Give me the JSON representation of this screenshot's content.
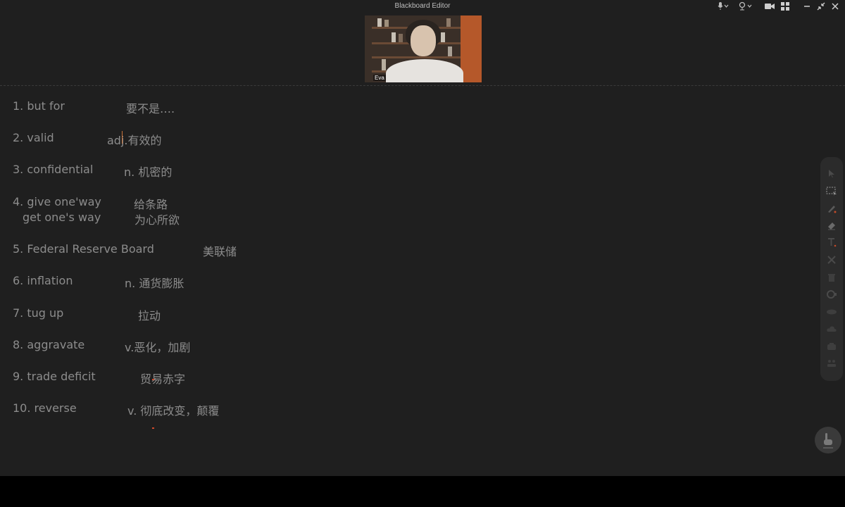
{
  "window": {
    "title": "Blackboard Editor"
  },
  "video": {
    "participant_name": "Eva"
  },
  "vocabulary": [
    {
      "term": "1. but for",
      "definition": "要不是…."
    },
    {
      "term": "2. valid",
      "definition": "adj.有效的"
    },
    {
      "term": "3. confidential",
      "definition": "n. 机密的"
    },
    {
      "term": "4. give one'way",
      "definition": "给条路"
    },
    {
      "term": "get one's way",
      "definition": "为心所欲"
    },
    {
      "term": "5. Federal Reserve Board",
      "definition": "美联储"
    },
    {
      "term": "6. inflation",
      "definition": "n. 通货膨胀"
    },
    {
      "term": "7. tug up",
      "definition": "拉动"
    },
    {
      "term": "8. aggravate",
      "definition": "v.恶化，加剧"
    },
    {
      "term": "9. trade deficit",
      "definition": "贸易赤字"
    },
    {
      "term": "10. reverse",
      "definition": "v. 彻底改变，颠覆"
    }
  ],
  "toolbar": {
    "tools": [
      "cursor-icon",
      "select-region-icon",
      "pen-icon",
      "eraser-icon",
      "text-icon",
      "clear-icon",
      "delete-icon",
      "record-icon",
      "shapes-icon",
      "cloud-icon",
      "template-icon",
      "more-icon"
    ]
  },
  "colors": {
    "background": "#1f1f1f",
    "text": "#8c8c8c",
    "accent": "#c9733a",
    "toolbar": "#2b2b2b"
  }
}
